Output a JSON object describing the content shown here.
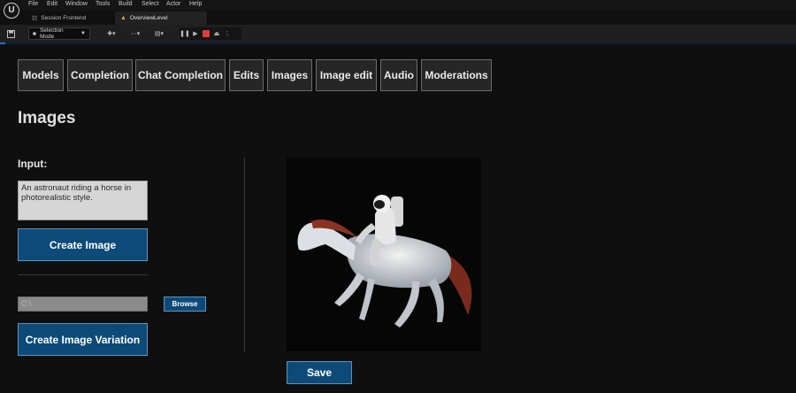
{
  "menu": [
    "File",
    "Edit",
    "Window",
    "Tools",
    "Build",
    "Select",
    "Actor",
    "Help"
  ],
  "tabs": {
    "session_frontend": "Session Frontend",
    "overview_level": "OverviewLevel"
  },
  "toolbar": {
    "mode": "Selection Mode"
  },
  "nav": [
    "Models",
    "Completion",
    "Chat Completion",
    "Edits",
    "Images",
    "Image edit",
    "Audio",
    "Moderations"
  ],
  "page": {
    "title": "Images",
    "input_label": "Input:",
    "prompt_value": "An astronaut riding a horse in photorealistic style.",
    "create_button": "Create Image",
    "path_placeholder": "C:\\",
    "browse_button": "Browse",
    "variation_button": "Create Image Variation",
    "save_button": "Save"
  },
  "colors": {
    "accent_button": "#0d4a78",
    "stop_red": "#e23b3b",
    "level_icon": "#e8a33a"
  }
}
